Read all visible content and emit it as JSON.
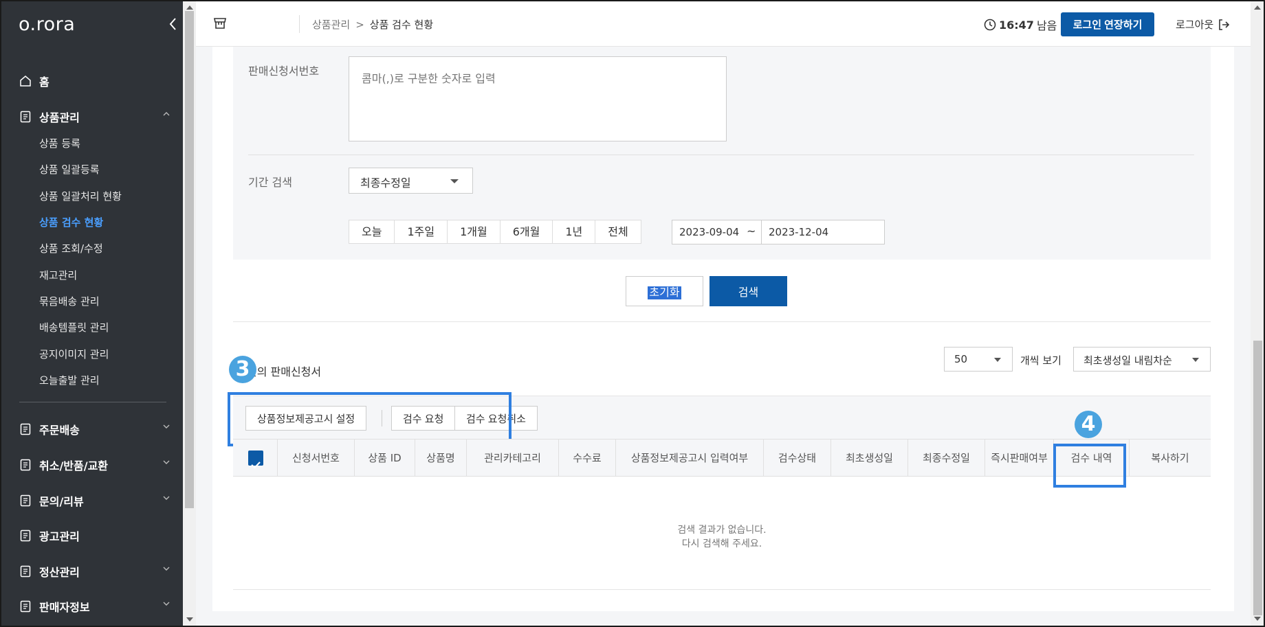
{
  "app": {
    "logo": "o.rora"
  },
  "sidebar": {
    "home": "홈",
    "product_mgmt": "상품관리",
    "sub_items": [
      "상품 등록",
      "상품 일괄등록",
      "상품 일괄처리 현황",
      "상품 검수 현황",
      "상품 조회/수정",
      "재고관리",
      "묶음배송 관리",
      "배송템플릿 관리",
      "공지이미지 관리",
      "오늘출발 관리"
    ],
    "sections": [
      "주문배송",
      "취소/반품/교환",
      "문의/리뷰",
      "광고관리",
      "정산관리",
      "판매자정보"
    ]
  },
  "header": {
    "breadcrumb_parent": "상품관리",
    "breadcrumb_sep": ">",
    "breadcrumb_current": "상품 검수 현황",
    "timer_value": "16:47",
    "timer_suffix": "남음",
    "extend_label": "로그인 연장하기",
    "logout_label": "로그아웃"
  },
  "filters": {
    "order_no_label": "판매신청서번호",
    "order_no_placeholder": "콤마(,)로 구분한 숫자로 입력",
    "period_label": "기간 검색",
    "date_type": "최종수정일",
    "periods": [
      "오늘",
      "1주일",
      "1개월",
      "6개월",
      "1년",
      "전체"
    ],
    "date_from": "2023-09-04",
    "date_tilde": "~",
    "date_to": "2023-12-04",
    "reset_label": "초기화",
    "search_label": "검색"
  },
  "results": {
    "title_suffix": "건의 판매신청서",
    "per_page": "50",
    "per_page_label": "개씩 보기",
    "sort": "최초생성일 내림차순",
    "actions": [
      "상품정보제공고시 설정",
      "검수 요청",
      "검수 요청취소"
    ],
    "columns": [
      "신청서번호",
      "상품 ID",
      "상품명",
      "관리카테고리",
      "수수료",
      "상품정보제공고시 입력여부",
      "검수상태",
      "최초생성일",
      "최종수정일",
      "즉시판매여부",
      "검수 내역",
      "복사하기"
    ],
    "empty_line1": "검색 결과가 없습니다.",
    "empty_line2": "다시 검색해 주세요."
  },
  "annotations": {
    "badge_3": "3",
    "badge_4": "4",
    "color": "#2f7fe0"
  }
}
